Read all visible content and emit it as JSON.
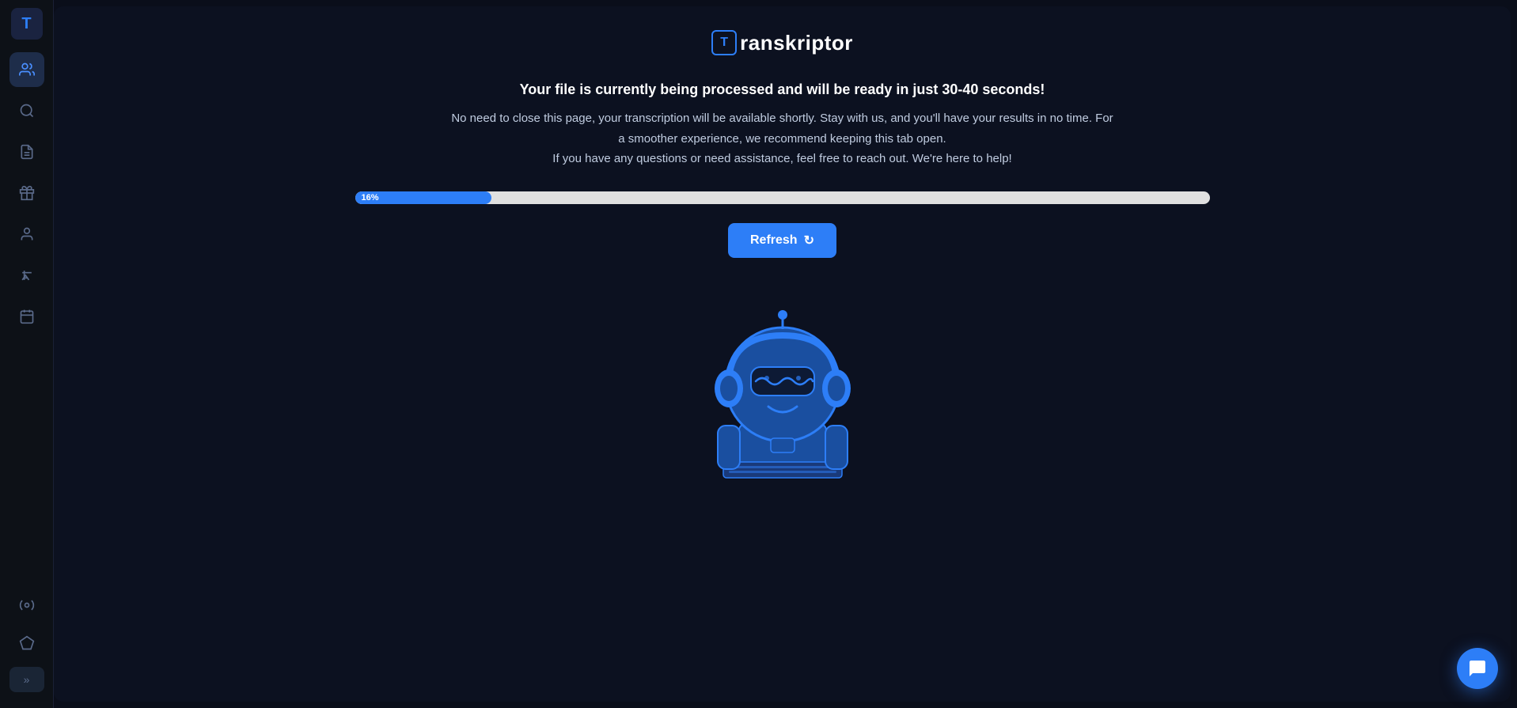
{
  "brand": {
    "logo_letter": "T",
    "name": "ranskriptor"
  },
  "sidebar": {
    "items": [
      {
        "id": "team",
        "icon": "👥",
        "label": "Team",
        "active": true
      },
      {
        "id": "search",
        "icon": "🔍",
        "label": "Search",
        "active": false
      },
      {
        "id": "documents",
        "icon": "📄",
        "label": "Documents",
        "active": false
      },
      {
        "id": "gift",
        "icon": "🎁",
        "label": "Gift",
        "active": false
      },
      {
        "id": "user",
        "icon": "👤",
        "label": "User",
        "active": false
      },
      {
        "id": "translate",
        "icon": "🌐",
        "label": "Translate",
        "active": false
      },
      {
        "id": "calendar",
        "icon": "📅",
        "label": "Calendar",
        "active": false
      },
      {
        "id": "tools",
        "icon": "🔧",
        "label": "Tools",
        "active": false
      },
      {
        "id": "diamond",
        "icon": "💎",
        "label": "Premium",
        "active": false
      }
    ],
    "expand_label": "»"
  },
  "main": {
    "message1": "Your file is currently being processed and will be ready in just 30-40 seconds!",
    "message2": "No need to close this page, your transcription will be available shortly. Stay with us, and you'll have your results in no time. For",
    "message3": "a smoother experience, we recommend keeping this tab open.",
    "message4": "If you have any questions or need assistance, feel free to reach out. We're here to help!",
    "progress_percent": 16,
    "progress_label": "16%",
    "refresh_button_label": "Refresh",
    "refresh_icon": "↻"
  },
  "colors": {
    "accent_blue": "#2d7ef7",
    "bg_dark": "#0c1120",
    "sidebar_bg": "#0d1117",
    "text_primary": "#ffffff",
    "text_secondary": "#c0cce0",
    "progress_bg": "#e0e0e0"
  }
}
